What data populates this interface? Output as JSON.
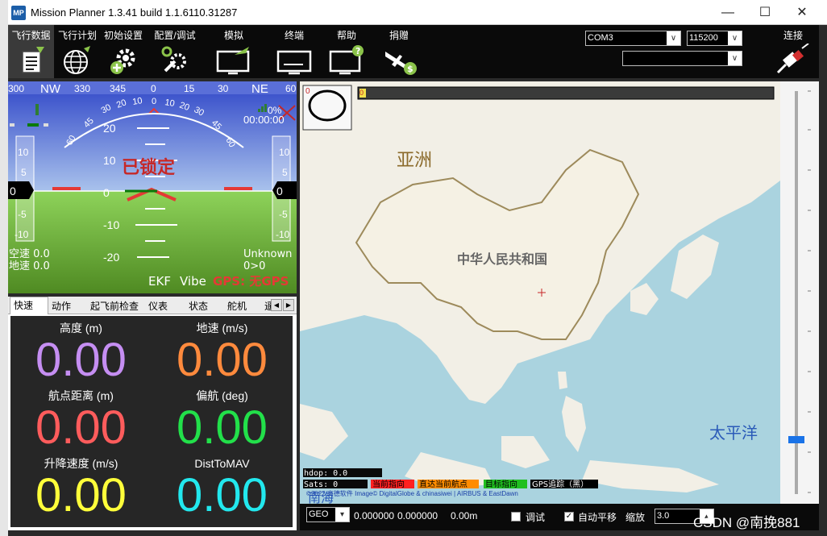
{
  "window": {
    "icon_text": "MP",
    "title": "Mission Planner 1.3.41 build 1.1.6110.31287",
    "minimize": "—",
    "maximize": "☐",
    "close": "✕"
  },
  "toolbar": {
    "items": [
      {
        "label": "飞行数据",
        "icon": "flight-data-icon"
      },
      {
        "label": "飞行计划",
        "icon": "globe-icon"
      },
      {
        "label": "初始设置",
        "icon": "gear-add-icon"
      },
      {
        "label": "配置/调试",
        "icon": "wrench-gear-icon"
      },
      {
        "label": "模拟",
        "icon": "monitor-plane-icon"
      },
      {
        "label": "终端",
        "icon": "monitor-terminal-icon"
      },
      {
        "label": "帮助",
        "icon": "monitor-help-icon"
      },
      {
        "label": "捐赠",
        "icon": "plane-dollar-icon"
      }
    ],
    "port": "COM3",
    "baud": "115200",
    "link_select": "",
    "connect_label": "连接"
  },
  "hud": {
    "heading_ticks": [
      "300",
      "NW",
      "330",
      "345",
      "0",
      "15",
      "30",
      "NE",
      "60"
    ],
    "pitch_up": [
      "20",
      "10"
    ],
    "pitch_zero": "0",
    "pitch_down": [
      "-10",
      "-20"
    ],
    "roll_scale": [
      "60",
      "45",
      "30",
      "20",
      "10",
      "0",
      "10",
      "20",
      "30",
      "45",
      "60"
    ],
    "left_tape": [
      "10",
      "5",
      "0",
      "-5",
      "-10"
    ],
    "right_tape": [
      "10",
      "5",
      "0",
      "-5",
      "-10"
    ],
    "left_tape_value": "0",
    "right_tape_value": "0",
    "battery_pct": "0%",
    "clock": "00:00:00",
    "status_locked": "已锁定",
    "airspeed": "空速 0.0",
    "groundspeed": "地速 0.0",
    "mode": "Unknown",
    "wp": "0>0",
    "ekf": "EKF",
    "vibe": "Vibe",
    "gps": "GPS: 无GPS"
  },
  "tabs": {
    "items": [
      "快速",
      "动作",
      "起飞前检查",
      "仪表",
      "状态",
      "舵机",
      "遥"
    ],
    "active": "快速"
  },
  "quick": {
    "cells": [
      {
        "label": "高度 (m)",
        "value": "0.00",
        "color": "#c58ef2"
      },
      {
        "label": "地速 (m/s)",
        "value": "0.00",
        "color": "#ff8a3d"
      },
      {
        "label": "航点距离 (m)",
        "value": "0.00",
        "color": "#ff5c5c"
      },
      {
        "label": "偏航 (deg)",
        "value": "0.00",
        "color": "#22e04a"
      },
      {
        "label": "升降速度 (m/s)",
        "value": "0.00",
        "color": "#ffff3a"
      },
      {
        "label": "DistToMAV",
        "value": "0.00",
        "color": "#22e8ee"
      }
    ]
  },
  "map": {
    "label_asia": "亚洲",
    "label_china": "中华人民共和国",
    "label_pacific": "太平洋",
    "label_sea": "南海",
    "hdop": "hdop: 0.0",
    "sats": "Sats: 0",
    "legend": [
      {
        "text": "当前指向",
        "bg": "#ff2020",
        "fg": "#000000"
      },
      {
        "text": "直达当前航点",
        "bg": "#ff8c00",
        "fg": "#000000"
      },
      {
        "text": "目标指向",
        "bg": "#20c020",
        "fg": "#000000"
      },
      {
        "text": "GPS追踪（黑）",
        "bg": "#000000",
        "fg": "#ffffff"
      }
    ],
    "copyright": "©2022 高德软件 Image© DigitalGlobe & chinasiwei | AIRBUS & EastDawn",
    "compass_value": "0",
    "batt_value": "0"
  },
  "geobar": {
    "coord_type": "GEO",
    "lat": "0.000000",
    "lng": "0.000000",
    "alt": "0.00m",
    "debug_label": "调试",
    "debug_checked": false,
    "autopan_label": "自动平移",
    "autopan_checked": true,
    "zoom_label": "缩放",
    "zoom_value": "3.0"
  },
  "watermark": "CSDN @南挽881"
}
